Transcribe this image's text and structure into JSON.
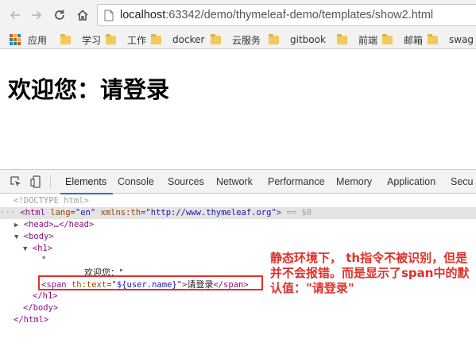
{
  "browser": {
    "url_host": "localhost",
    "url_rest": ":63342/demo/thymeleaf-demo/templates/show2.html"
  },
  "bookmarks": [
    {
      "label": "应用",
      "icon": "apps-grid-icon"
    },
    {
      "label": "学习",
      "icon": "folder-icon"
    },
    {
      "label": "工作",
      "icon": "folder-icon"
    },
    {
      "label": "docker",
      "icon": "folder-icon"
    },
    {
      "label": "云服务",
      "icon": "folder-icon"
    },
    {
      "label": "gitbook",
      "icon": "folder-icon"
    },
    {
      "label": "前端",
      "icon": "folder-icon"
    },
    {
      "label": "邮箱",
      "icon": "folder-icon"
    },
    {
      "label": "swag",
      "icon": "folder-icon"
    }
  ],
  "page": {
    "heading": "欢迎您：请登录"
  },
  "devtools": {
    "tabs": [
      "Elements",
      "Console",
      "Sources",
      "Network",
      "Performance",
      "Memory",
      "Application",
      "Secu"
    ],
    "active_tab": "Elements",
    "dom": {
      "doctype": "<!DOCTYPE html>",
      "html_open_tag": "html",
      "html_lang_attr": "lang",
      "html_lang_val": "\"en\"",
      "html_xmlns_attr": "xmlns:th",
      "html_xmlns_val": "\"http://www.thymeleaf.org\"",
      "selected_marker": "== $0",
      "head_collapsed": "<head>…</head>",
      "body_open": "<body>",
      "h1_open": "<h1>",
      "text_quote_open": "\"",
      "text_welcome": "欢迎您：\"",
      "span_open": "<span",
      "span_attr": "th:text",
      "span_attr_val": "\"${user.name}\"",
      "span_text": "请登录",
      "span_close": "</span>",
      "h1_close": "</h1>",
      "body_close": "</body>",
      "html_close": "</html>"
    }
  },
  "annotation": {
    "text": "静态环境下， th指令不被识别，但是并不会报错。而是显示了span中的默认值：\"请登录\"",
    "color": "#e0302a"
  }
}
